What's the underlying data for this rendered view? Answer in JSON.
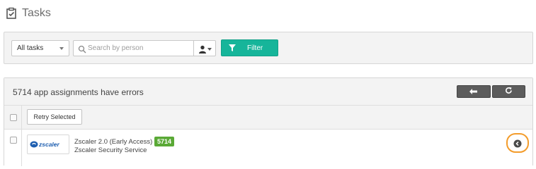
{
  "page": {
    "title": "Tasks"
  },
  "filters": {
    "task_select_value": "All tasks",
    "search_placeholder": "Search by person",
    "filter_label": "Filter"
  },
  "results": {
    "header_title": "5714 app assignments have errors",
    "retry_label": "Retry Selected",
    "rows": [
      {
        "logo_text": "zscaler",
        "app_name": "Zscaler 2.0 (Early Access)",
        "app_subtitle": "Zscaler Security Service",
        "error_count": "5714"
      }
    ]
  },
  "icons": {
    "title": "clipboard-check-icon",
    "search": "search-icon",
    "person": "person-icon",
    "filter": "filter-icon",
    "back": "arrow-left-icon",
    "refresh": "refresh-icon",
    "expand": "chevron-circle-left-icon"
  },
  "colors": {
    "accent": "#16b59a",
    "badge": "#5aa936",
    "highlight_ring": "#f39c2b",
    "dark_button": "#5c5c5c"
  }
}
